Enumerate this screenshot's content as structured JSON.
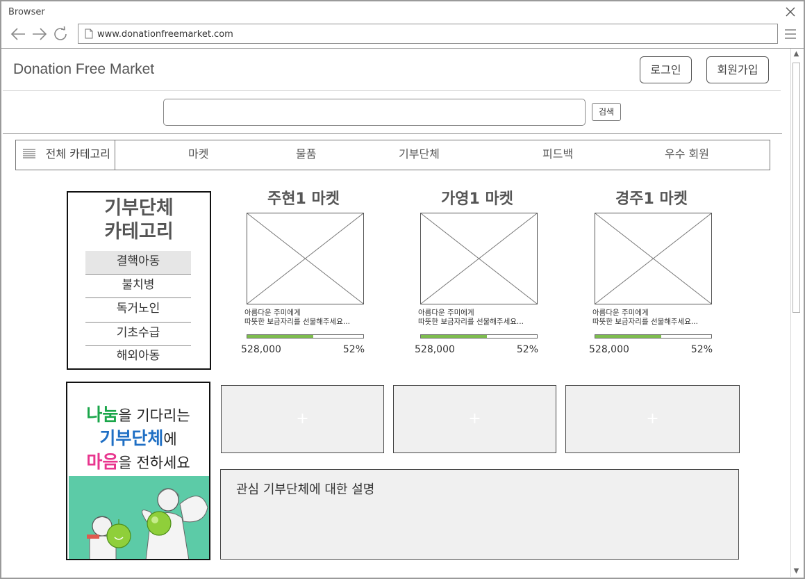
{
  "browser": {
    "title": "Browser",
    "url": "www.donationfreemarket.com"
  },
  "header": {
    "site_title": "Donation Free Market",
    "login_label": "로그인",
    "signup_label": "회원가입"
  },
  "search": {
    "value": "",
    "button_label": "검색"
  },
  "nav": {
    "all_label": "전체 카테고리",
    "items": [
      "마켓",
      "물품",
      "기부단체",
      "피드백",
      "우수 회원"
    ]
  },
  "sidebar": {
    "heading_line1": "기부단체",
    "heading_line2": "카테고리",
    "items": [
      "결핵아동",
      "불치병",
      "독거노인",
      "기초수급",
      "해외아동"
    ],
    "active_index": 0
  },
  "markets": [
    {
      "name": "주현1 마켓",
      "desc_line1": "아름다운 주미에게",
      "desc_line2": "따뜻한 보금자리를 선물해주세요...",
      "amount": "528,000",
      "percent_label": "52%",
      "progress": 0.57
    },
    {
      "name": "가영1 마켓",
      "desc_line1": "아름다운 주미에게",
      "desc_line2": "따뜻한 보금자리를 선물해주세요...",
      "amount": "528,000",
      "percent_label": "52%",
      "progress": 0.57
    },
    {
      "name": "경주1 마켓",
      "desc_line1": "아름다운 주미에게",
      "desc_line2": "따뜻한 보금자리를 선물해주세요...",
      "amount": "528,000",
      "percent_label": "52%",
      "progress": 0.57
    }
  ],
  "banner": {
    "line1_highlight": "나눔",
    "line1_rest": "을 기다리는",
    "line2_highlight": "기부단체",
    "line2_rest": "에",
    "line3_highlight": "마음",
    "line3_rest": "을 전하세요"
  },
  "add_slots": [
    "+",
    "+",
    "+"
  ],
  "description": {
    "text": "관심 기부단체에 대한 설명"
  },
  "colors": {
    "progress_fill": "#7dbd4e",
    "banner_bg": "#5ccba7",
    "green": "#1aa64a",
    "blue": "#1f6fc4",
    "pink": "#e8358e"
  }
}
